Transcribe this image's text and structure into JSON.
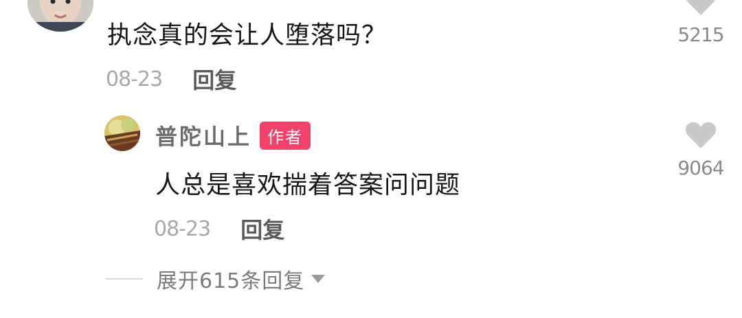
{
  "comment": {
    "text": "执念真的会让人堕落吗？",
    "date": "08-23",
    "reply_label": "回复",
    "likes": "5215"
  },
  "reply": {
    "username": "普陀山上",
    "author_badge": "作者",
    "text": "人总是喜欢揣着答案问问题",
    "date": "08-23",
    "reply_label": "回复",
    "likes": "9064"
  },
  "expand": {
    "label": "展开615条回复"
  },
  "colors": {
    "badge": "#f2416b",
    "heart": "#c9c9c9",
    "text": "#161616",
    "muted": "#a8a8a8"
  },
  "icons": {
    "like": "heart-icon",
    "expand": "caret-down-icon"
  }
}
